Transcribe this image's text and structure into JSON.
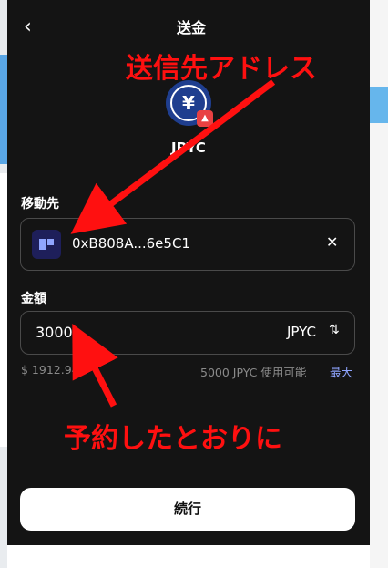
{
  "header": {
    "back_icon": "chevron-left-icon",
    "title": "送金"
  },
  "token": {
    "symbol": "¥",
    "name": "JPYC",
    "badge_icon": "avalanche-icon"
  },
  "recipient": {
    "label": "移動先",
    "address": "0xB808A...6e5C1",
    "clear_icon": "close-icon"
  },
  "amount": {
    "label": "金額",
    "value": "3000",
    "unit": "JPYC",
    "swap_icon": "swap-vertical-icon"
  },
  "balance": {
    "usd": "$ 1912.94",
    "available": "5000 JPYC 使用可能",
    "max_label": "最大"
  },
  "primary_button": {
    "label": "続行"
  },
  "annotations": {
    "top": "送信先アドレス",
    "bottom": "予約したとおりに",
    "color": "#ff1010"
  },
  "colors": {
    "panel_bg": "#141414",
    "accent_blue": "#8fa5ff",
    "token_blue": "#1f3e8f",
    "badge_red": "#e84142"
  }
}
